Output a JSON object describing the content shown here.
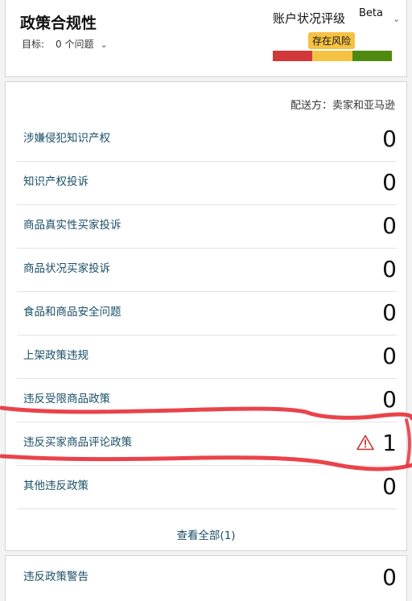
{
  "header": {
    "title": "政策合规性",
    "target_label": "目标:",
    "target_value": "0 个问题",
    "health_label": "账户状况评级",
    "beta_label": "Beta",
    "risk_label": "存在风险",
    "risk_bar_colors": [
      "#d1383a",
      "#f5c242",
      "#4f8a10"
    ],
    "accent_color": "#1a4f66"
  },
  "body": {
    "shipped_by": "配送方：卖家和亚马逊",
    "rows": [
      {
        "label": "涉嫌侵犯知识产权",
        "count": "0"
      },
      {
        "label": "知识产权投诉",
        "count": "0"
      },
      {
        "label": "商品真实性买家投诉",
        "count": "0"
      },
      {
        "label": "商品状况买家投诉",
        "count": "0"
      },
      {
        "label": "食品和商品安全问题",
        "count": "0"
      },
      {
        "label": "上架政策违规",
        "count": "0"
      },
      {
        "label": "违反受限商品政策",
        "count": "0"
      },
      {
        "label": "违反买家商品评论政策",
        "count": "1",
        "warning": true
      },
      {
        "label": "其他违反政策",
        "count": "0"
      }
    ],
    "view_all": "查看全部(1)"
  },
  "footer": {
    "label": "违反政策警告",
    "count": "0"
  }
}
